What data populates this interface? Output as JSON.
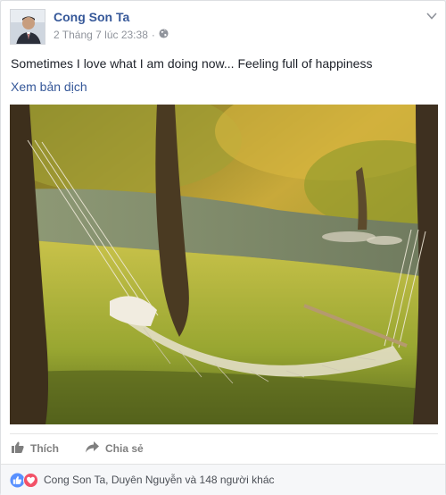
{
  "post": {
    "author_name": "Cong Son Ta",
    "timestamp": "2 Tháng 7 lúc 23:38",
    "separator": "·",
    "privacy_icon": "globe-icon",
    "options_icon": "chevron-down-icon",
    "text": "Sometimes I love what I am doing now... Feeling full of happiness",
    "translate_link": "Xem bản dịch",
    "photo_alt": "hammock-photo"
  },
  "actions": {
    "like_label": "Thích",
    "share_label": "Chia sẻ"
  },
  "reactions": {
    "icons": [
      "like-icon",
      "love-icon"
    ],
    "summary": "Cong Son Ta, Duyên Nguyễn và 148 người khác"
  },
  "colors": {
    "link": "#365899",
    "meta": "#90949c",
    "like_blue": "#5890ff",
    "love_red": "#f25268"
  }
}
